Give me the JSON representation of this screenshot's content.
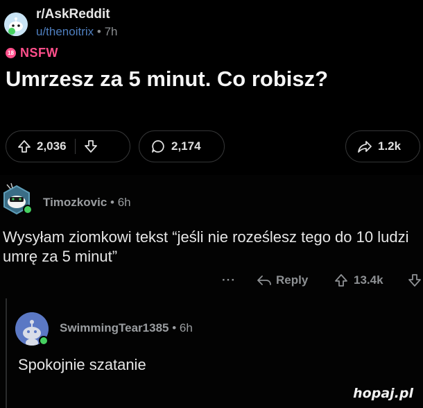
{
  "post": {
    "subreddit": "r/AskReddit",
    "author": "u/thenoitrix",
    "separator": "•",
    "age": "7h",
    "nsfw_badge": "18",
    "nsfw_label": "NSFW",
    "title": "Umrzesz za 5 minut. Co robisz?",
    "upvotes": "2,036",
    "comments": "2,174",
    "shares": "1.2k"
  },
  "comments": [
    {
      "author": "Timozkovic",
      "separator": "•",
      "age": "6h",
      "body": "Wysyłam ziomkowi tekst “jeśli nie roześlesz tego do 10 ludzi umrę za 5 minut”",
      "more": "···",
      "reply_label": "Reply",
      "score": "13.4k"
    },
    {
      "author": "SwimmingTear1385",
      "separator": "•",
      "age": "6h",
      "body": "Spokojnie szatanie"
    }
  ],
  "watermark": "hopaj.pl",
  "colors": {
    "background": "#000000",
    "nsfw": "#ff4f8b",
    "username_link": "#4f7fbf",
    "online": "#46d160"
  },
  "icons": [
    "subreddit-avatar-icon",
    "upvote-icon",
    "downvote-icon",
    "comment-icon",
    "share-icon",
    "reply-icon",
    "more-icon"
  ]
}
